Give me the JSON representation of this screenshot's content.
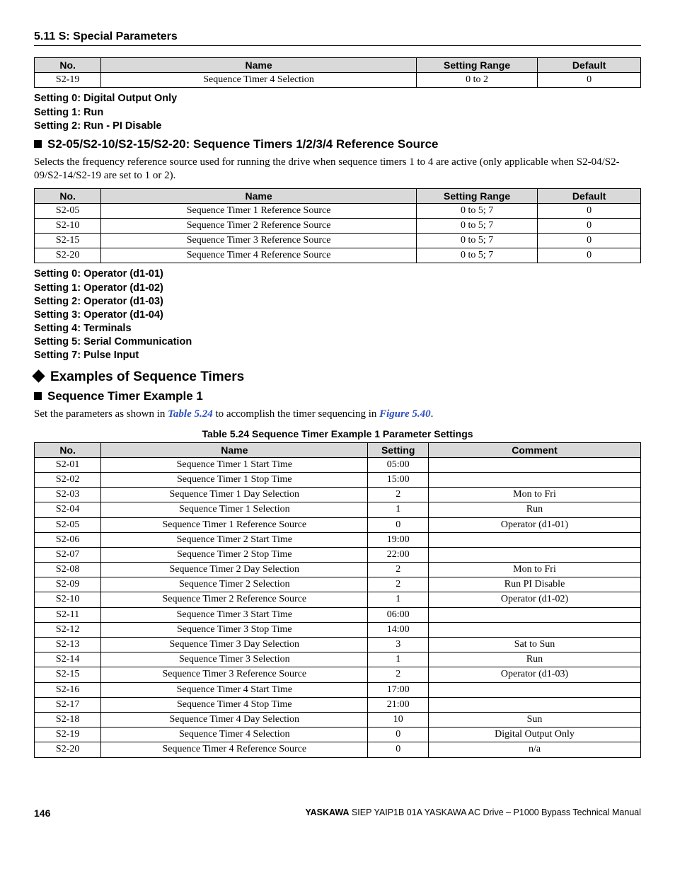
{
  "section_header": "5.11 S: Special Parameters",
  "table1": {
    "headers": [
      "No.",
      "Name",
      "Setting Range",
      "Default"
    ],
    "rows": [
      {
        "no": "S2-19",
        "name": "Sequence Timer 4 Selection",
        "range": "0 to 2",
        "def": "0"
      }
    ]
  },
  "settings_block1": [
    "Setting 0: Digital Output Only",
    "Setting 1: Run",
    "Setting 2: Run - PI Disable"
  ],
  "heading_ref_source": "S2-05/S2-10/S2-15/S2-20: Sequence Timers 1/2/3/4 Reference Source",
  "para_ref_source": "Selects the frequency reference source used for running the drive when sequence timers 1 to 4 are active (only applicable when S2-04/S2-09/S2-14/S2-19 are set to 1 or 2).",
  "table2": {
    "headers": [
      "No.",
      "Name",
      "Setting Range",
      "Default"
    ],
    "rows": [
      {
        "no": "S2-05",
        "name": "Sequence Timer 1 Reference Source",
        "range": "0 to 5; 7",
        "def": "0"
      },
      {
        "no": "S2-10",
        "name": "Sequence Timer 2 Reference Source",
        "range": "0 to 5; 7",
        "def": "0"
      },
      {
        "no": "S2-15",
        "name": "Sequence Timer 3 Reference Source",
        "range": "0 to 5; 7",
        "def": "0"
      },
      {
        "no": "S2-20",
        "name": "Sequence Timer 4 Reference Source",
        "range": "0 to 5; 7",
        "def": "0"
      }
    ]
  },
  "settings_block2": [
    "Setting 0: Operator (d1-01)",
    "Setting 1: Operator (d1-02)",
    "Setting 2: Operator (d1-03)",
    "Setting 3: Operator (d1-04)",
    "Setting 4: Terminals",
    "Setting 5: Serial Communication",
    "Setting 7: Pulse Input"
  ],
  "heading_examples": "Examples of Sequence Timers",
  "heading_example1": "Sequence Timer Example 1",
  "para_example1_pre": "Set the parameters as shown in ",
  "link_table": "Table 5.24",
  "para_example1_mid": " to accomplish the timer sequencing in ",
  "link_figure": "Figure 5.40",
  "para_example1_post": ".",
  "table3_caption": "Table 5.24  Sequence Timer Example 1 Parameter Settings",
  "table3": {
    "headers": [
      "No.",
      "Name",
      "Setting",
      "Comment"
    ],
    "rows": [
      {
        "no": "S2-01",
        "name": "Sequence Timer 1 Start Time",
        "setting": "05:00",
        "comment": ""
      },
      {
        "no": "S2-02",
        "name": "Sequence Timer 1 Stop Time",
        "setting": "15:00",
        "comment": ""
      },
      {
        "no": "S2-03",
        "name": "Sequence Timer 1 Day Selection",
        "setting": "2",
        "comment": "Mon to Fri"
      },
      {
        "no": "S2-04",
        "name": "Sequence Timer 1 Selection",
        "setting": "1",
        "comment": "Run"
      },
      {
        "no": "S2-05",
        "name": "Sequence Timer 1 Reference Source",
        "setting": "0",
        "comment": "Operator (d1-01)"
      },
      {
        "no": "S2-06",
        "name": "Sequence Timer 2 Start Time",
        "setting": "19:00",
        "comment": ""
      },
      {
        "no": "S2-07",
        "name": "Sequence Timer 2 Stop Time",
        "setting": "22:00",
        "comment": ""
      },
      {
        "no": "S2-08",
        "name": "Sequence Timer 2 Day Selection",
        "setting": "2",
        "comment": "Mon to Fri"
      },
      {
        "no": "S2-09",
        "name": "Sequence Timer 2 Selection",
        "setting": "2",
        "comment": "Run PI Disable"
      },
      {
        "no": "S2-10",
        "name": "Sequence Timer 2 Reference Source",
        "setting": "1",
        "comment": "Operator (d1-02)"
      },
      {
        "no": "S2-11",
        "name": "Sequence Timer 3 Start Time",
        "setting": "06:00",
        "comment": ""
      },
      {
        "no": "S2-12",
        "name": "Sequence Timer 3 Stop Time",
        "setting": "14:00",
        "comment": ""
      },
      {
        "no": "S2-13",
        "name": "Sequence Timer 3 Day Selection",
        "setting": "3",
        "comment": "Sat to Sun"
      },
      {
        "no": "S2-14",
        "name": "Sequence Timer 3 Selection",
        "setting": "1",
        "comment": "Run"
      },
      {
        "no": "S2-15",
        "name": "Sequence Timer 3 Reference Source",
        "setting": "2",
        "comment": "Operator (d1-03)"
      },
      {
        "no": "S2-16",
        "name": "Sequence Timer 4 Start Time",
        "setting": "17:00",
        "comment": ""
      },
      {
        "no": "S2-17",
        "name": "Sequence Timer 4 Stop Time",
        "setting": "21:00",
        "comment": ""
      },
      {
        "no": "S2-18",
        "name": "Sequence Timer 4 Day Selection",
        "setting": "10",
        "comment": "Sun"
      },
      {
        "no": "S2-19",
        "name": "Sequence Timer 4 Selection",
        "setting": "0",
        "comment": "Digital Output Only"
      },
      {
        "no": "S2-20",
        "name": "Sequence Timer 4 Reference Source",
        "setting": "0",
        "comment": "n/a"
      }
    ]
  },
  "footer": {
    "page": "146",
    "brand": "YASKAWA",
    "rest": " SIEP YAIP1B 01A YASKAWA AC Drive – P1000 Bypass Technical Manual"
  }
}
